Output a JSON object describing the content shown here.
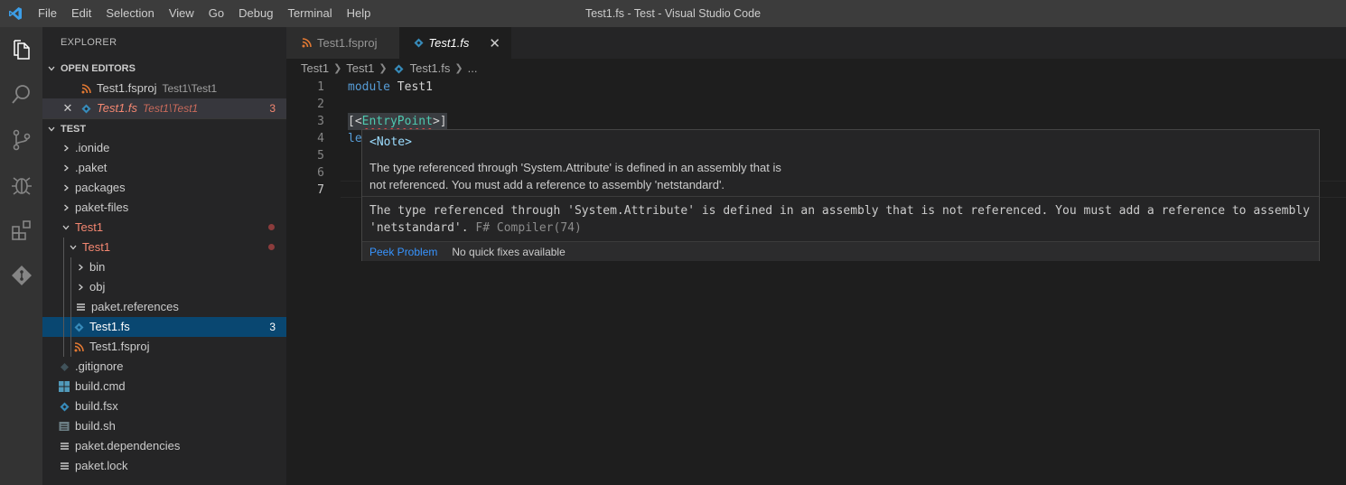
{
  "window": {
    "title": "Test1.fs - Test - Visual Studio Code"
  },
  "menu": [
    "File",
    "Edit",
    "Selection",
    "View",
    "Go",
    "Debug",
    "Terminal",
    "Help"
  ],
  "sidebar": {
    "title": "EXPLORER",
    "open_editors_header": "OPEN EDITORS",
    "open_editors": [
      {
        "name": "Test1.fsproj",
        "path": "Test1\\Test1"
      },
      {
        "name": "Test1.fs",
        "path": "Test1\\Test1",
        "badge": "3"
      }
    ],
    "workspace_header": "TEST",
    "tree": [
      {
        "name": ".ionide"
      },
      {
        "name": ".paket"
      },
      {
        "name": "packages"
      },
      {
        "name": "paket-files"
      },
      {
        "name": "Test1"
      },
      {
        "name": "Test1"
      },
      {
        "name": "bin"
      },
      {
        "name": "obj"
      },
      {
        "name": "paket.references"
      },
      {
        "name": "Test1.fs",
        "badge": "3"
      },
      {
        "name": "Test1.fsproj"
      },
      {
        "name": ".gitignore"
      },
      {
        "name": "build.cmd"
      },
      {
        "name": "build.fsx"
      },
      {
        "name": "build.sh"
      },
      {
        "name": "paket.dependencies"
      },
      {
        "name": "paket.lock"
      }
    ]
  },
  "tabs": [
    {
      "label": "Test1.fsproj"
    },
    {
      "label": "Test1.fs",
      "close": "✕"
    }
  ],
  "breadcrumbs": [
    "Test1",
    "Test1",
    "Test1.fs",
    "..."
  ],
  "code": {
    "line_numbers": [
      "1",
      "2",
      "3",
      "4",
      "5",
      "6",
      "7"
    ],
    "line1_kw": "module",
    "line1_name": " Test1",
    "line3_open": "[<",
    "line3_attr": "EntryPoint",
    "line3_close": ">]",
    "line4_partial": "le"
  },
  "hover": {
    "signature": "<Note>",
    "doc_line1": "The type referenced through 'System.Attribute' is defined in an assembly that is",
    "doc_line2": "not referenced. You must add a reference to assembly 'netstandard'.",
    "diag_line1": "The type referenced through 'System.Attribute' is defined in an assembly that is not referenced. You must add a reference to assembly",
    "diag_line2": "'netstandard'.",
    "diag_source": "F# Compiler(74)",
    "peek_label": "Peek Problem",
    "no_fixes_label": "No quick fixes available"
  },
  "colors": {
    "accent": "#007acc",
    "error": "#f48771",
    "selection": "#094771"
  }
}
